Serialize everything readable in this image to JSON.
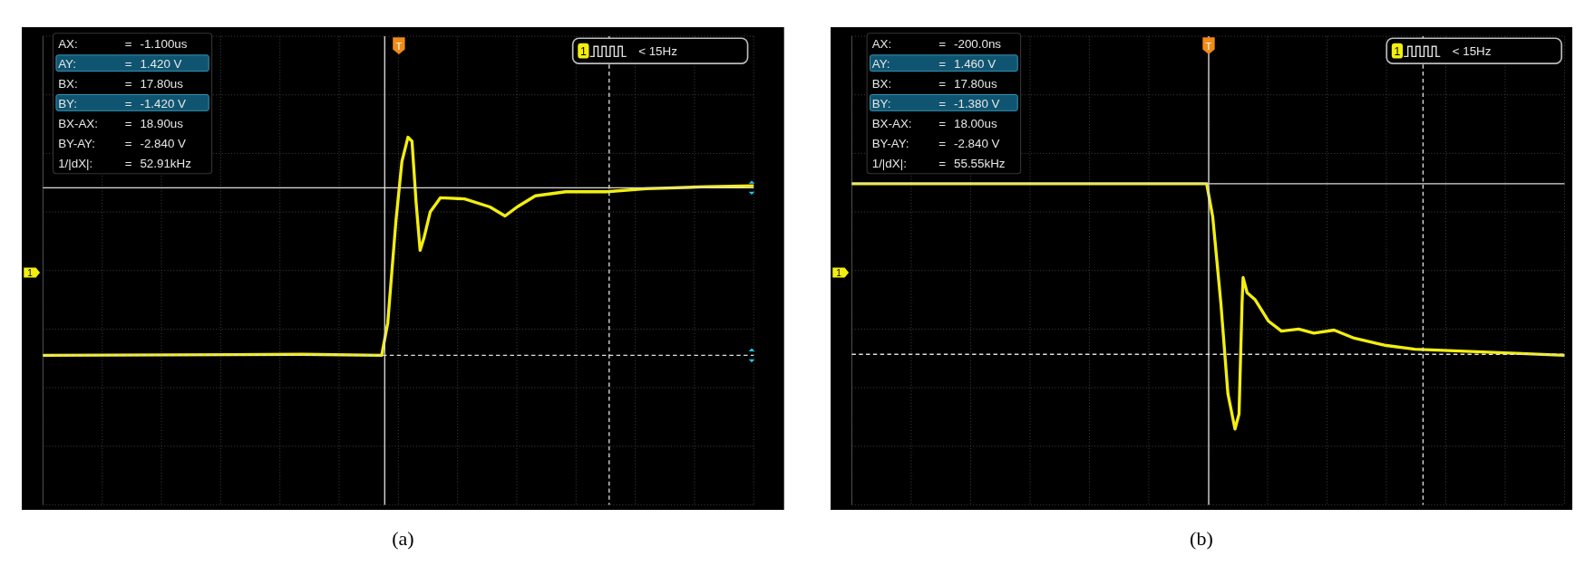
{
  "figures": [
    {
      "caption": "(a)",
      "scope": {
        "trigger_label": "T",
        "channel_marker": "1",
        "cursor_arrows": true,
        "readouts": [
          {
            "label": "AX:",
            "relation": "=",
            "value": "-1.100us",
            "selected": false
          },
          {
            "label": "AY:",
            "relation": "=",
            "value": "1.420 V",
            "selected": true
          },
          {
            "label": "BX:",
            "relation": "=",
            "value": "17.80us",
            "selected": false
          },
          {
            "label": "BY:",
            "relation": "=",
            "value": "-1.420 V",
            "selected": true
          },
          {
            "label": "BX-AX:",
            "relation": "=",
            "value": "18.90us",
            "selected": false
          },
          {
            "label": "BY-AY:",
            "relation": "=",
            "value": "-2.840 V",
            "selected": false
          },
          {
            "label": "1/|dX|:",
            "relation": "=",
            "value": "52.91kHz",
            "selected": false
          }
        ],
        "trigger_info": {
          "channel": "1",
          "frequency": "< 15Hz"
        }
      }
    },
    {
      "caption": "(b)",
      "scope": {
        "trigger_label": "T",
        "channel_marker": "1",
        "cursor_arrows": false,
        "readouts": [
          {
            "label": "AX:",
            "relation": "=",
            "value": "-200.0ns",
            "selected": false
          },
          {
            "label": "AY:",
            "relation": "=",
            "value": "1.460 V",
            "selected": true
          },
          {
            "label": "BX:",
            "relation": "=",
            "value": "17.80us",
            "selected": false
          },
          {
            "label": "BY:",
            "relation": "=",
            "value": "-1.380 V",
            "selected": true
          },
          {
            "label": "BX-AX:",
            "relation": "=",
            "value": "18.00us",
            "selected": false
          },
          {
            "label": "BY-AY:",
            "relation": "=",
            "value": "-2.840 V",
            "selected": false
          },
          {
            "label": "1/|dX|:",
            "relation": "=",
            "value": "55.55kHz",
            "selected": false
          }
        ],
        "trigger_info": {
          "channel": "1",
          "frequency": "< 15Hz"
        }
      }
    }
  ]
}
